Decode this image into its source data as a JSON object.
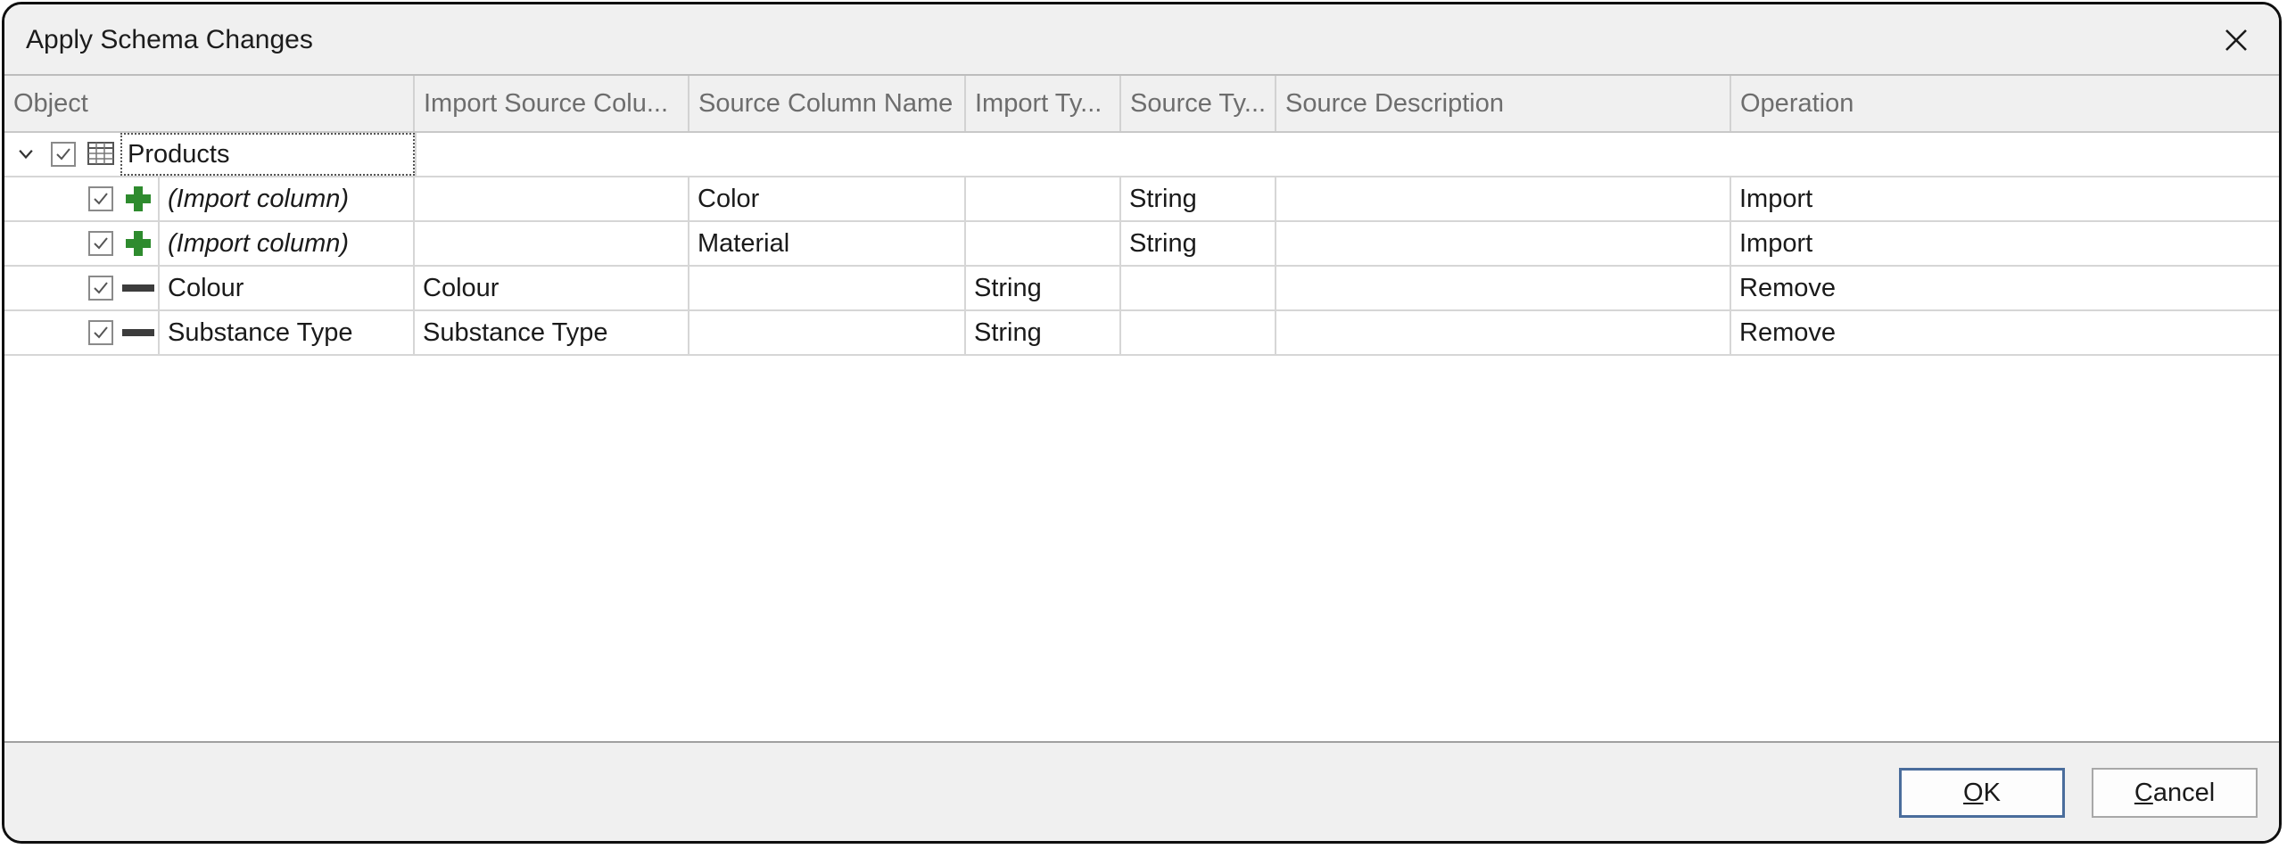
{
  "window": {
    "title": "Apply Schema Changes"
  },
  "columns": [
    "Object",
    "Import Source Colu...",
    "Source Column Name",
    "Import Ty...",
    "Source Ty...",
    "Source Description",
    "Operation"
  ],
  "tree": {
    "root": {
      "label": "Products",
      "checked": true,
      "expanded": true,
      "icon": "table-icon"
    },
    "rows": [
      {
        "icon": "plus-icon",
        "object": "(Import column)",
        "italic": true,
        "import_source_column": "",
        "source_column_name": "Color",
        "import_type": "",
        "source_type": "String",
        "source_description": "",
        "operation": "Import",
        "checked": true
      },
      {
        "icon": "plus-icon",
        "object": "(Import column)",
        "italic": true,
        "import_source_column": "",
        "source_column_name": "Material",
        "import_type": "",
        "source_type": "String",
        "source_description": "",
        "operation": "Import",
        "checked": true
      },
      {
        "icon": "minus-icon",
        "object": "Colour",
        "italic": false,
        "import_source_column": "Colour",
        "source_column_name": "",
        "import_type": "String",
        "source_type": "",
        "source_description": "",
        "operation": "Remove",
        "checked": true
      },
      {
        "icon": "minus-icon",
        "object": "Substance Type",
        "italic": false,
        "import_source_column": "Substance Type",
        "source_column_name": "",
        "import_type": "String",
        "source_type": "",
        "source_description": "",
        "operation": "Remove",
        "checked": true
      }
    ]
  },
  "buttons": {
    "ok": {
      "accesskey": "O",
      "rest": "K"
    },
    "cancel": {
      "accesskey": "C",
      "rest": "ancel"
    }
  },
  "colors": {
    "plus": "#2e8b2e",
    "minus": "#3c3c3c",
    "default_button_border": "#4a6d9c"
  }
}
